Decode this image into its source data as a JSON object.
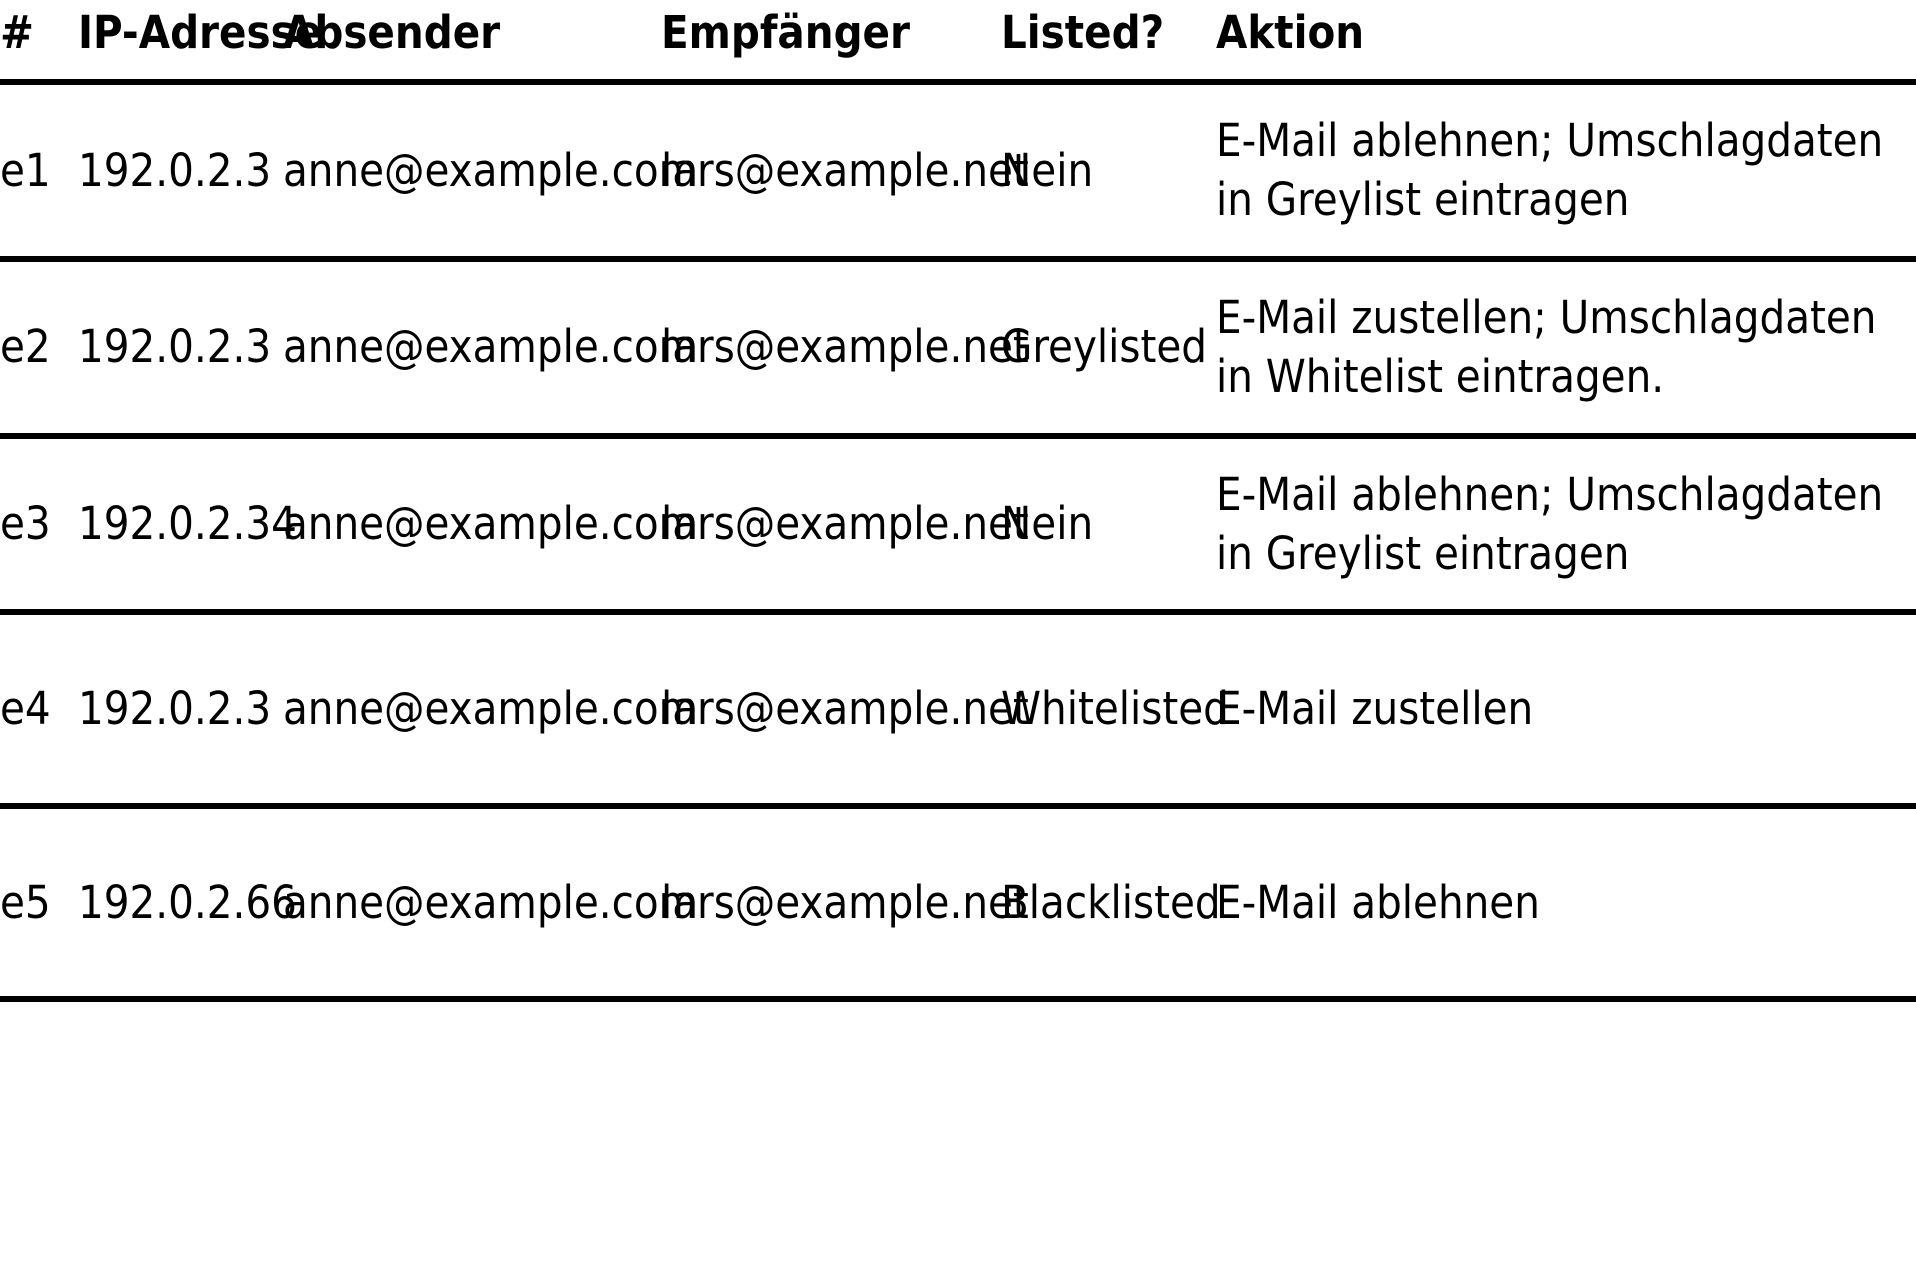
{
  "table": {
    "columns": [
      {
        "key": "num",
        "label": "#"
      },
      {
        "key": "ip",
        "label": "IP-Adresse"
      },
      {
        "key": "sender",
        "label": "Absender"
      },
      {
        "key": "rcpt",
        "label": "Empfänger"
      },
      {
        "key": "listed",
        "label": "Listed?"
      },
      {
        "key": "action",
        "label": "Aktion"
      }
    ],
    "rows": [
      {
        "num": "e1",
        "ip": "192.0.2.3",
        "sender": "anne@example.com",
        "rcpt": "lars@example.net",
        "listed": "Nein",
        "action": "E-Mail ablehnen; Umschlagdaten in Greylist eintragen"
      },
      {
        "num": "e2",
        "ip": "192.0.2.3",
        "sender": "anne@example.com",
        "rcpt": "lars@example.net",
        "listed": "Greylisted",
        "action": "E-Mail zustellen; Umschlagdaten in Whitelist eintragen."
      },
      {
        "num": "e3",
        "ip": "192.0.2.34",
        "sender": "anne@example.com",
        "rcpt": "lars@example.net",
        "listed": "Nein",
        "action": "E-Mail ablehnen; Umschlagdaten in Greylist eintragen"
      },
      {
        "num": "e4",
        "ip": "192.0.2.3",
        "sender": "anne@example.com",
        "rcpt": "lars@example.net",
        "listed": "Whitelisted",
        "action": "E-Mail zustellen"
      },
      {
        "num": "e5",
        "ip": "192.0.2.66",
        "sender": "anne@example.com",
        "rcpt": "lars@example.net",
        "listed": "Blacklisted",
        "action": "E-Mail ablehnen"
      }
    ]
  },
  "style": {
    "rule_color": "#000000",
    "text_color": "#000000",
    "background": "#ffffff"
  }
}
